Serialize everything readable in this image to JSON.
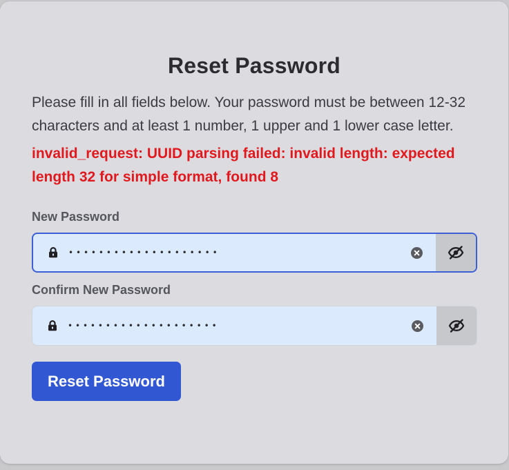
{
  "form": {
    "title": "Reset Password",
    "description": "Please fill in all fields below. Your password must be between 12-32 characters and at least 1 number, 1 upper and 1 lower case letter.",
    "error": "invalid_request: UUID parsing failed: invalid length: expected length 32 for simple format, found 8",
    "new_password": {
      "label": "New Password",
      "value_masked": "••••••••••••••••••••",
      "state": "focused",
      "lead_icon": "lock-icon",
      "clear_icon": "clear-circle-icon",
      "toggle_icon": "eye-slash-icon"
    },
    "confirm_password": {
      "label": "Confirm New Password",
      "value_masked": "••••••••••••••••••••",
      "state": "default",
      "lead_icon": "lock-icon",
      "clear_icon": "clear-circle-icon",
      "toggle_icon": "eye-slash-icon"
    },
    "submit_label": "Reset Password"
  },
  "colors": {
    "card_background": "#dcdce0",
    "error": "#e0191f",
    "primary_button": "#3157d3",
    "input_background": "#dceafd",
    "focus_border": "#3d5fd6"
  }
}
